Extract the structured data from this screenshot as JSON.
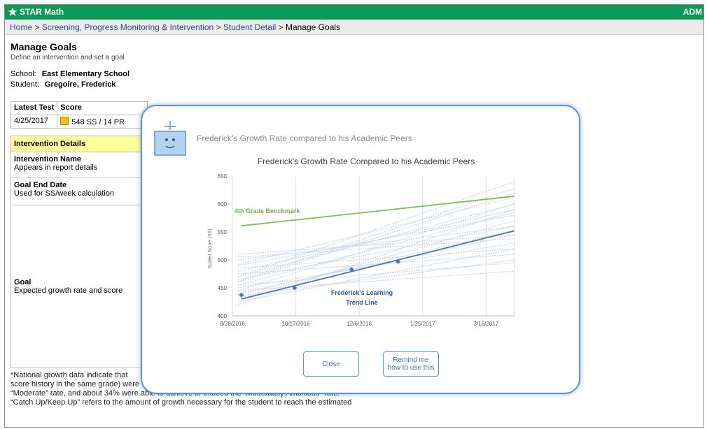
{
  "app": {
    "name": "STAR Math",
    "admin_label": "ADM"
  },
  "breadcrumb": {
    "home": "Home",
    "screening": "Screening, Progress Monitoring & Intervention",
    "student_detail": "Student Detail",
    "current": "Manage Goals",
    "separator": ">"
  },
  "page": {
    "title": "Manage Goals",
    "subtitle": "Define an intervention and set a goal"
  },
  "school": {
    "label": "School:",
    "value": "East Elementary School"
  },
  "student": {
    "label": "Student:",
    "value": "Gregoire, Frederick"
  },
  "test_table": {
    "headers": [
      "Latest Test",
      "Score"
    ],
    "date": "4/25/2017",
    "score": "548 SS / 14 PR",
    "score_color": "#f5c400"
  },
  "intervention": {
    "header": "Intervention Details",
    "rows": [
      {
        "title": "Intervention Name",
        "desc": "Appears in report details"
      },
      {
        "title": "Goal End Date",
        "desc": "Used for SS/week calculation"
      },
      {
        "title": "Goal",
        "desc": "Expected growth rate and score"
      }
    ]
  },
  "footnote": {
    "line1": "*National growth data indicate that ",
    "line2": "score history in the same grade) were ",
    "line3": "“Moderate” rate, and about 34% were able to achieve or exceed the “Moderately Ambitious” rate.",
    "line4": "“Catch Up/Keep Up” refers to the amount of growth necessary for the student to reach the estimated"
  },
  "modal": {
    "title": "Frederick's Growth Rate compared to his Academic Peers",
    "close_label": "Close",
    "remind_label_1": "Remind me",
    "remind_label_2": "how to use this",
    "border_color": "#5b95d6"
  },
  "chart_data": {
    "type": "line",
    "title": "Frederick's Growth Rate Compared to his Academic Peers",
    "ylabel": "Scaled Score (SS)",
    "xlabel": "",
    "ylim": [
      400,
      650
    ],
    "y_ticks": [
      400,
      450,
      500,
      550,
      600,
      650
    ],
    "x_ticks": [
      "8/28/2016",
      "10/17/2016",
      "12/6/2016",
      "1/25/2017",
      "3/16/2017"
    ],
    "x_range": [
      "2016-08-28",
      "2017-04-03"
    ],
    "grid": "vertical",
    "series": [
      {
        "name": "4th Grade Benchmark",
        "color": "#7cc24d",
        "x": [
          "2016-09-04",
          "2017-04-03"
        ],
        "y": [
          561,
          614
        ]
      },
      {
        "name": "Frederick's Learning Trend Line",
        "color": "#4c76bd",
        "x": [
          "2016-09-04",
          "2017-04-03"
        ],
        "y": [
          430,
          552
        ]
      },
      {
        "name": "",
        "color": "#4c76bd",
        "marker": "diamond",
        "x": [
          "2016-09-04",
          "2016-10-15",
          "2016-11-28",
          "2017-01-03"
        ],
        "y": [
          437,
          450,
          483,
          497
        ]
      }
    ],
    "peer_lines": [
      [
        460,
        620
      ],
      [
        445,
        600
      ],
      [
        470,
        640
      ],
      [
        430,
        570
      ],
      [
        455,
        585
      ],
      [
        480,
        590
      ],
      [
        440,
        545
      ],
      [
        465,
        560
      ],
      [
        450,
        530
      ],
      [
        490,
        580
      ],
      [
        425,
        520
      ],
      [
        475,
        510
      ],
      [
        500,
        560
      ],
      [
        435,
        500
      ],
      [
        485,
        520
      ],
      [
        455,
        495
      ],
      [
        510,
        545
      ],
      [
        445,
        480
      ],
      [
        470,
        600
      ],
      [
        420,
        590
      ],
      [
        462,
        628
      ],
      [
        438,
        553
      ],
      [
        492,
        612
      ],
      [
        505,
        538
      ]
    ],
    "peer_color": "#c4d4ec",
    "annotations": [
      "4th Grade Benchmark",
      "Frederick's Learning",
      "Trend Line"
    ]
  }
}
